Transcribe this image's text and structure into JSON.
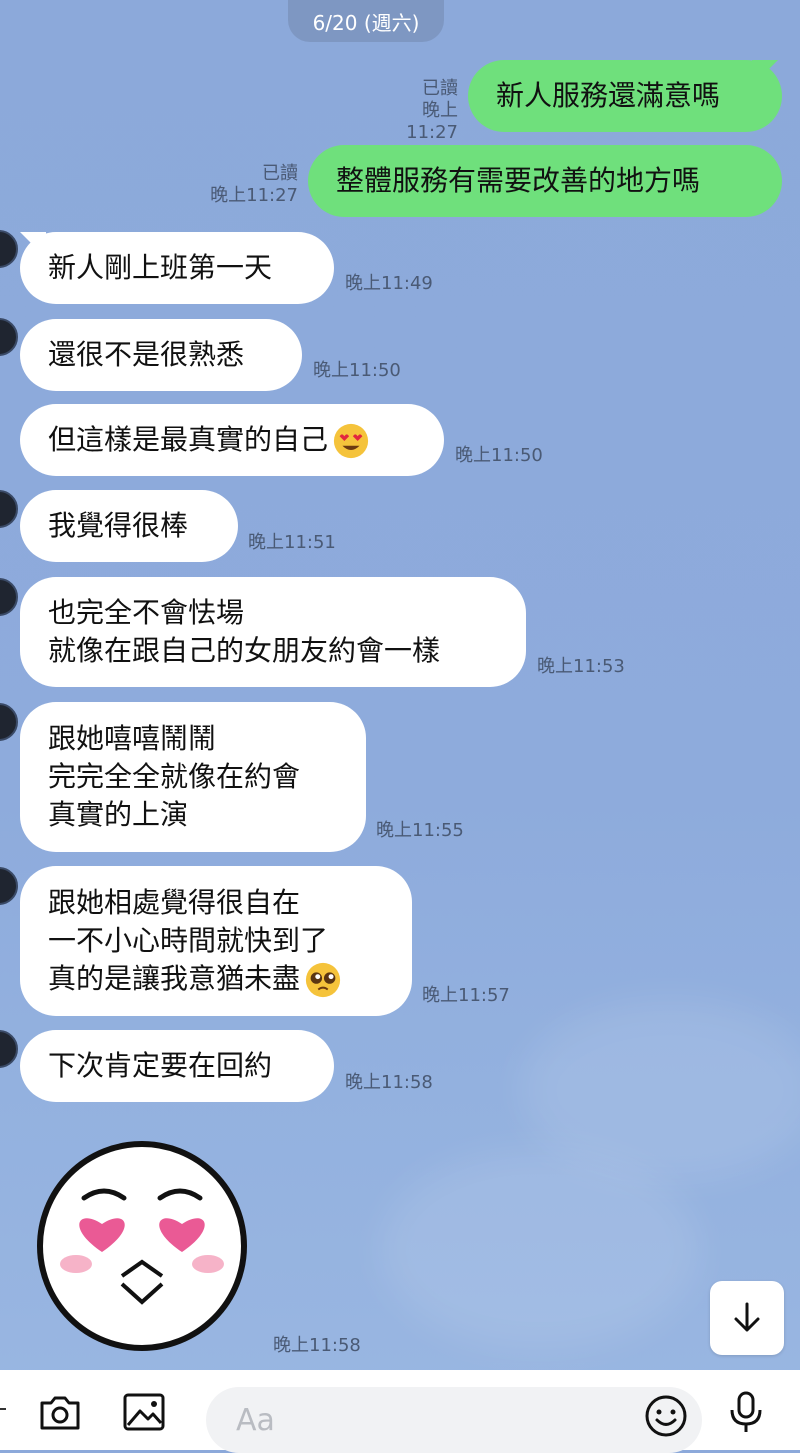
{
  "date_label": "6/20 (週六)",
  "outgoing": [
    {
      "text": "新人服務還滿意嗎",
      "read": "已讀",
      "time": "晚上11:27"
    },
    {
      "text": "整體服務有需要改善的地方嗎",
      "read": "已讀",
      "time": "晚上11:27"
    }
  ],
  "incoming": [
    {
      "lines": [
        "新人剛上班第一天"
      ],
      "time": "晚上11:49"
    },
    {
      "lines": [
        "還很不是很熟悉"
      ],
      "time": "晚上11:50"
    },
    {
      "lines": [
        "但這樣是最真實的自己"
      ],
      "time": "晚上11:50",
      "emoji": "heart-eyes-emoji"
    },
    {
      "lines": [
        "我覺得很棒"
      ],
      "time": "晚上11:51"
    },
    {
      "lines": [
        "也完全不會怯場",
        "就像在跟自己的女朋友約會一樣"
      ],
      "time": "晚上11:53"
    },
    {
      "lines": [
        "跟她嘻嘻鬧鬧",
        "完完全全就像在約會",
        "真實的上演"
      ],
      "time": "晚上11:55"
    },
    {
      "lines": [
        "跟她相處覺得很自在",
        "一不小心時間就快到了",
        "真的是讓我意猶未盡"
      ],
      "time": "晚上11:57",
      "emoji": "pleading-face-emoji"
    },
    {
      "lines": [
        "下次肯定要在回約"
      ],
      "time": "晚上11:58"
    }
  ],
  "sticker": {
    "name": "heart-eyes-blush-face-sticker",
    "time": "晚上11:58"
  },
  "composer": {
    "placeholder": "Aa",
    "icons": [
      "camera-icon",
      "image-icon",
      "emoji-icon",
      "microphone-icon"
    ]
  },
  "colors": {
    "background": "#8ca9da",
    "outgoing_bubble": "#6fe07c",
    "incoming_bubble": "#ffffff",
    "date_pill": "#7e97c2"
  }
}
